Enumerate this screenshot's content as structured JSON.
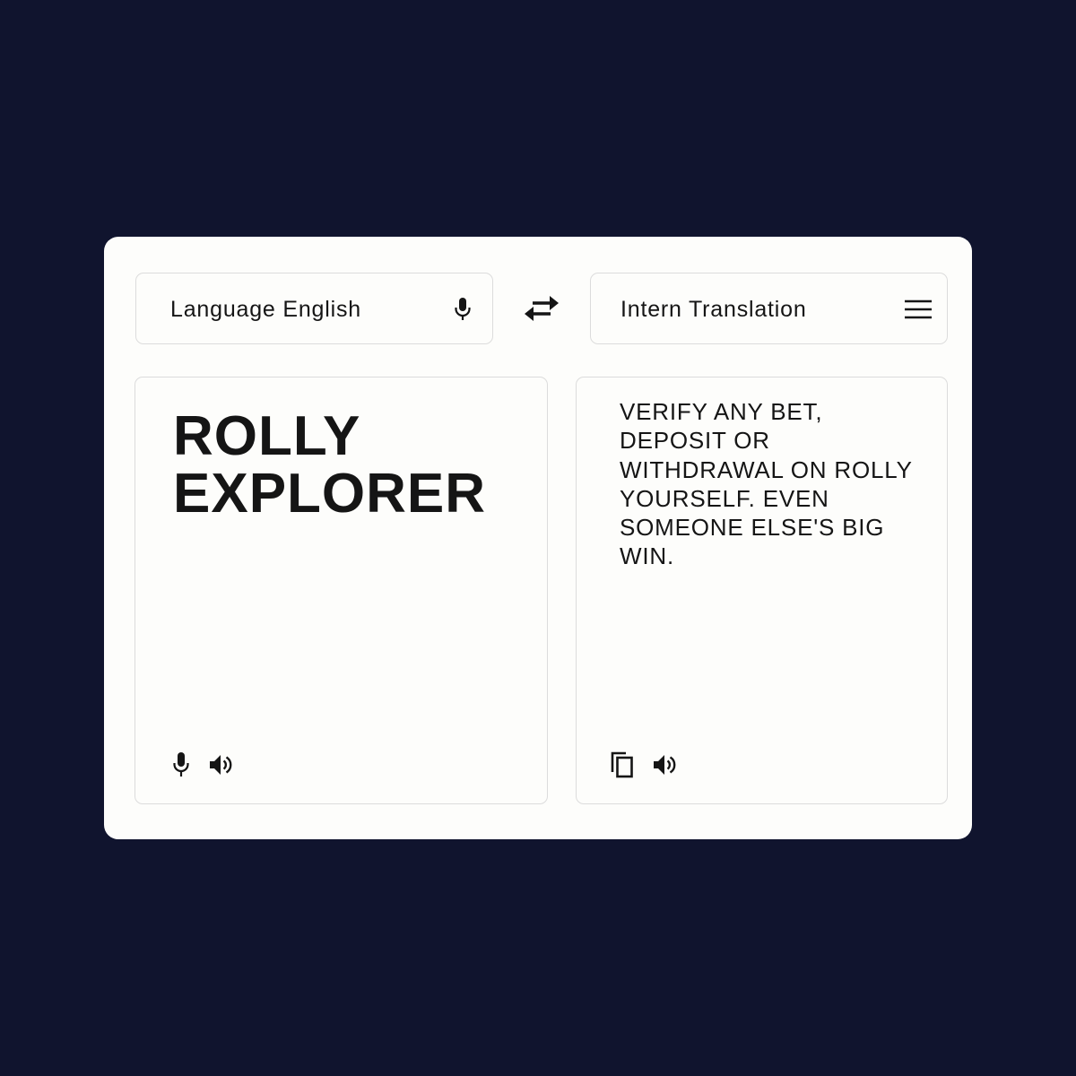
{
  "source": {
    "language_label": "Language English",
    "language_icon": "mic-icon",
    "text": "ROLLY EXPLORER",
    "actions": [
      "mic-icon",
      "speaker-icon"
    ]
  },
  "swap_icon": "swap-arrows-icon",
  "target": {
    "language_label": "Intern Translation",
    "menu_icon": "hamburger-menu-icon",
    "text": "VERIFY ANY BET, DEPOSIT OR WITHDRAWAL ON ROLLY YOURSELF. EVEN SOMEONE ELSE'S BIG WIN.",
    "actions": [
      "copy-icon",
      "speaker-icon"
    ]
  },
  "colors": {
    "background": "#10142e",
    "card": "#fdfdfb",
    "border": "#dcdcdc",
    "text": "#151515"
  }
}
